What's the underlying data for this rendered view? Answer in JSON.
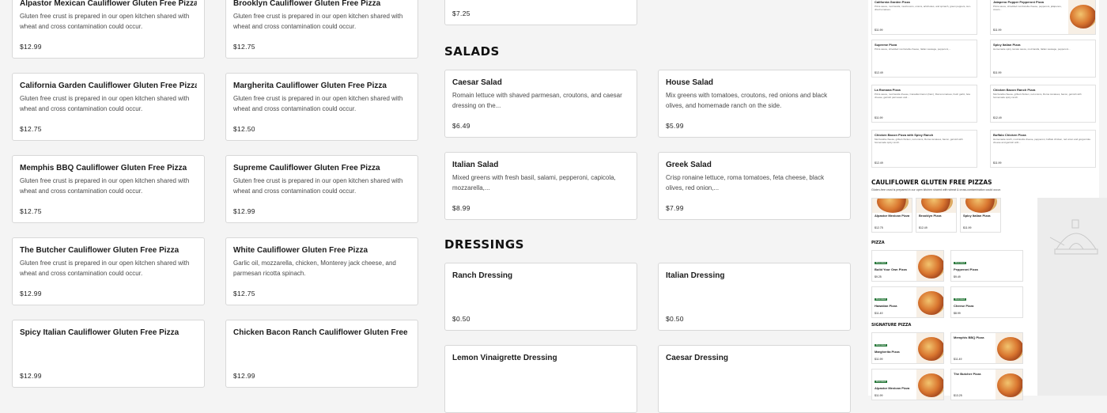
{
  "col1": [
    {
      "title": "Alpastor Mexican Cauliflower Gluten Free Pizza",
      "desc": "Gluten free crust is prepared in our open kitchen shared with wheat and cross contamination could occur.",
      "price": "$12.99"
    },
    {
      "title": "California Garden Cauliflower Gluten Free Pizza",
      "desc": "Gluten free crust is prepared in our open kitchen shared with wheat and cross contamination could occur.",
      "price": "$12.75"
    },
    {
      "title": "Memphis BBQ Cauliflower Gluten Free Pizza",
      "desc": "Gluten free crust is prepared in our open kitchen shared with wheat and cross contamination could occur.",
      "price": "$12.75"
    },
    {
      "title": "The Butcher Cauliflower Gluten Free Pizza",
      "desc": "Gluten free crust is prepared in our open kitchen shared with wheat and cross contamination could occur.",
      "price": "$12.99"
    },
    {
      "title": "Spicy Italian Cauliflower Gluten Free Pizza",
      "desc": "",
      "price": "$12.99"
    }
  ],
  "col2": [
    {
      "title": "Brooklyn Cauliflower Gluten Free Pizza",
      "desc": "Gluten free crust is prepared in our open kitchen shared with wheat and cross contamination could occur.",
      "price": "$12.75"
    },
    {
      "title": "Margherita Cauliflower Gluten Free Pizza",
      "desc": "Gluten free crust is prepared in our open kitchen shared with wheat and cross contamination could occur.",
      "price": "$12.50"
    },
    {
      "title": "Supreme Cauliflower Gluten Free Pizza",
      "desc": "Gluten free crust is prepared in our open kitchen shared with wheat and cross contamination could occur.",
      "price": "$12.99"
    },
    {
      "title": "White Cauliflower Gluten Free Pizza",
      "desc": "Garlic oil, mozzarella, chicken, Monterey jack cheese, and parmesan ricotta spinach.",
      "price": "$12.75"
    },
    {
      "title": "Chicken Bacon Ranch Cauliflower Gluten Free Pizza",
      "desc": "",
      "price": "$12.99"
    }
  ],
  "top_card": {
    "price": "$7.25"
  },
  "salads": {
    "heading": "SALADS",
    "items": [
      {
        "title": "Caesar Salad",
        "desc": "Romain lettuce with shaved parmesan, croutons, and caesar dressing on the...",
        "price": "$6.49"
      },
      {
        "title": "House Salad",
        "desc": "Mix greens with tomatoes, croutons, red onions and black olives, and homemade ranch on the side.",
        "price": "$5.99"
      },
      {
        "title": "Italian Salad",
        "desc": "Mixed greens with fresh basil, salami, pepperoni, capicola, mozzarella,...",
        "price": "$8.99"
      },
      {
        "title": "Greek Salad",
        "desc": "Crisp ronaine lettuce, roma tomatoes, feta cheese, black olives, red onion,...",
        "price": "$7.99"
      }
    ]
  },
  "dressings": {
    "heading": "DRESSINGS",
    "items": [
      {
        "title": "Ranch Dressing",
        "price": "$0.50"
      },
      {
        "title": "Italian Dressing",
        "price": "$0.50"
      },
      {
        "title": "Lemon Vinaigrette Dressing",
        "price": ""
      },
      {
        "title": "Caesar Dressing",
        "price": ""
      }
    ]
  },
  "thumbnail": {
    "cards": [
      {
        "title": "California Garden Pizza",
        "desc": "Pizza sauce, mozzarella, mushrooms, onions, artichokes, and spinach, green peppers, sun-dried tomatoes.",
        "price": "$11.99"
      },
      {
        "title": "Jalapeno Popper Pepperoni Pizza",
        "desc": "Pizza sauce, shredded mozzarella cheese, pepperoni, jalapenos, cream...",
        "price": "$11.99"
      },
      {
        "title": "Supreme Pizza",
        "desc": "Pizza sauce, shredded mozzarella cheese, Italian sausage, pepperoni,...",
        "price": "$12.49"
      },
      {
        "title": "Spicy Italian Pizza",
        "desc": "Homemade spicy tomato sauce, mozzarella, Italian sausage, pepperoni...",
        "price": "$11.99"
      },
      {
        "title": "La Romana Pizza",
        "desc": "Pizza sauce, mozzarella cheese, Canadian bacon (ham), Roma tomatoes, fresh garlic, feta cheese, garnish parmesan and...",
        "price": "$11.99"
      },
      {
        "title": "Chicken Bacon Ranch Pizza",
        "desc": "Mozzarella cheese, grilled chicken, red onions, Roma tomatoes, bacon, garnish with homemade spicy ranch.",
        "price": "$12.49"
      },
      {
        "title": "Chicken Bacon Pizza with Spicy Ranch",
        "desc": "Mozzarella cheese, grilled chicken, red onions, Roma tomatoes, bacon, garnish with homemade spicy ranch.",
        "price": "$12.49"
      },
      {
        "title": "Buffalo Chicken Pizza",
        "desc": "Homemade ranch, mozzarella cheese, pepperoni, buffalo chicken, red onion and gorgonzola cheese and garnish with...",
        "price": "$11.99"
      }
    ],
    "gf_heading": "CAULIFLOWER GLUTEN FREE PIZZAS",
    "gf_sub": "Gluten-free crust is prepared in our open kitchen shared with wheat & cross-contamination could occur.",
    "gf_cards": [
      {
        "title": "Alpastor Mexican Pizza",
        "price": "$12.75"
      },
      {
        "title": "Brooklyn Pizza",
        "price": "$12.49"
      },
      {
        "title": "Spicy Italian Pizza",
        "price": "$11.99"
      }
    ],
    "pizza_heading": "PIZZA",
    "pizza_cards": [
      {
        "badge": "Most Liked",
        "title": "Build Your Own Pizza",
        "price": "$9.25"
      },
      {
        "badge": "Most Liked",
        "title": "Pepperoni Pizza",
        "price": "$9.49"
      },
      {
        "badge": "Most Liked",
        "title": "Hawaiian Pizza",
        "price": "$11.49"
      },
      {
        "badge": "Most Liked",
        "title": "Cheese Pizza",
        "price": "$8.99"
      }
    ],
    "sig_heading": "SIGNATURE PIZZA",
    "sig_cards": [
      {
        "badge": "Most Liked",
        "title": "Margherita Pizza",
        "price": "$11.99"
      },
      {
        "badge": "",
        "title": "Memphis BBQ Pizza",
        "price": "$11.49"
      },
      {
        "badge": "Most Liked",
        "title": "Alpastor Mexican Pizza",
        "price": "$11.99"
      },
      {
        "badge": "",
        "title": "The Butcher Pizza",
        "price": "$13.25"
      }
    ]
  }
}
